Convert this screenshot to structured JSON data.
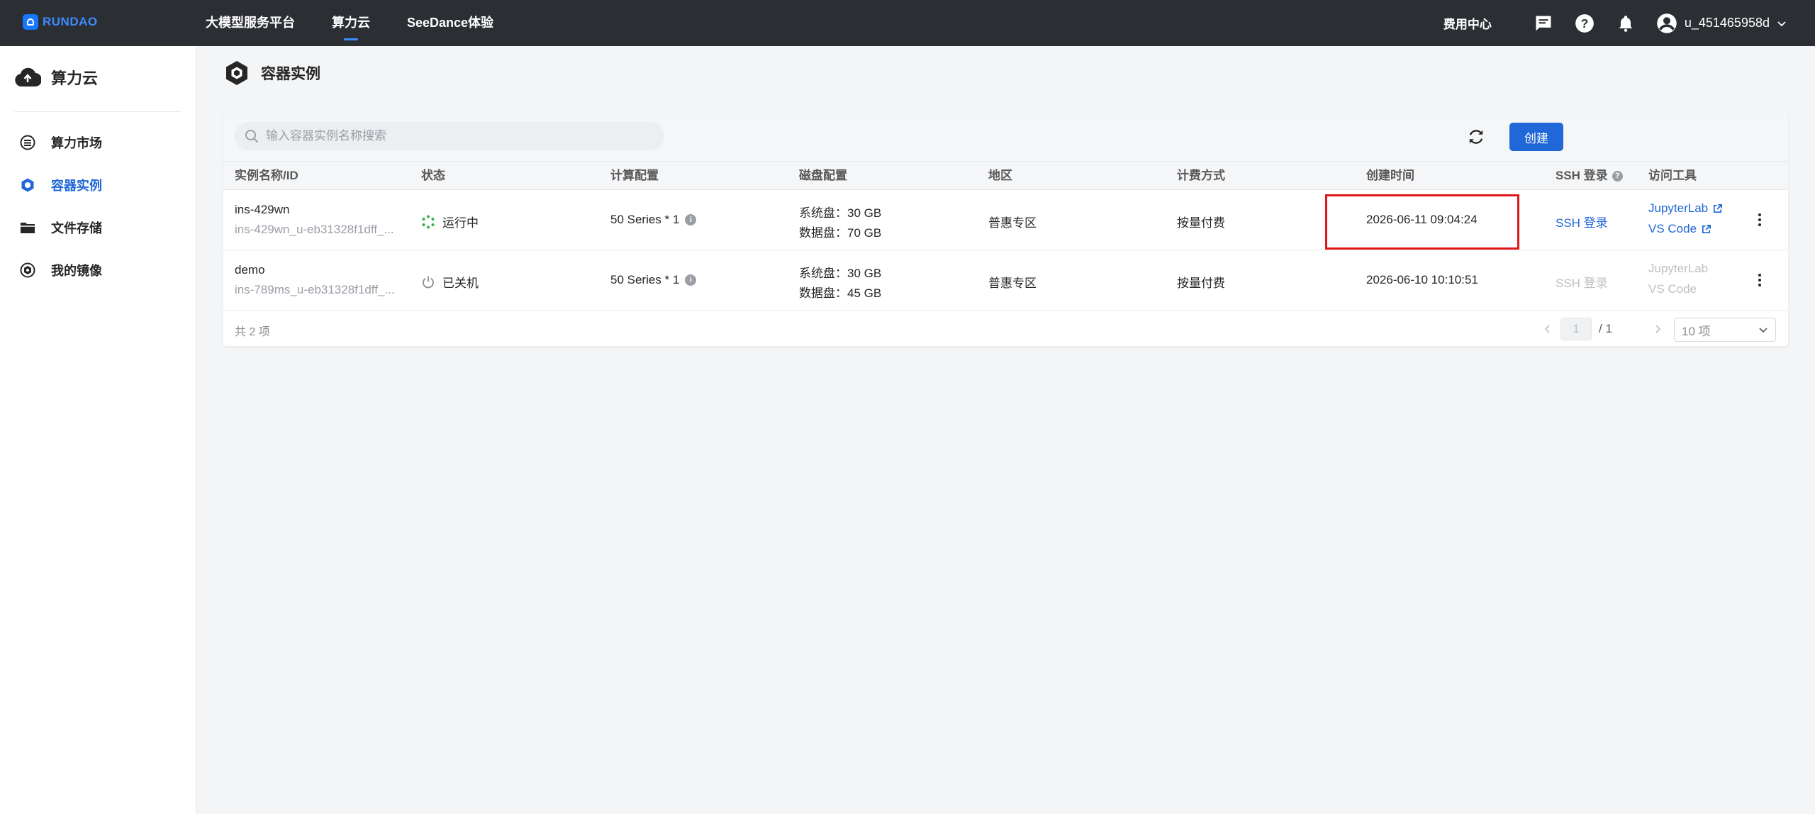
{
  "topbar": {
    "logo_text": "RUNDAO",
    "nav": [
      "大模型服务平台",
      "算力云",
      "SeeDance体验"
    ],
    "active_nav_index": 1,
    "fee_center": "费用中心",
    "username": "u_451465958d",
    "icons": [
      "message-icon",
      "help-icon",
      "bell-icon",
      "user-icon",
      "chevron-down-icon"
    ]
  },
  "sidebar": {
    "title": "算力云",
    "items": [
      {
        "label": "算力市场",
        "icon": "market-icon",
        "active": false
      },
      {
        "label": "容器实例",
        "icon": "container-icon",
        "active": true
      },
      {
        "label": "文件存储",
        "icon": "folder-icon",
        "active": false
      },
      {
        "label": "我的镜像",
        "icon": "image-icon",
        "active": false
      }
    ]
  },
  "page": {
    "title": "容器实例"
  },
  "toolbar": {
    "search_placeholder": "输入容器实例名称搜索",
    "create_label": "创建"
  },
  "table": {
    "columns": [
      "实例名称/ID",
      "状态",
      "计算配置",
      "磁盘配置",
      "地区",
      "计费方式",
      "创建时间",
      "SSH 登录",
      "访问工具"
    ],
    "rows": [
      {
        "name": "ins-429wn",
        "id": "ins-429wn_u-eb31328f1dff_...",
        "status": "运行中",
        "compute": "50 Series * 1",
        "system_disk": "系统盘：30 GB",
        "data_disk": "数据盘：70 GB",
        "region": "普惠专区",
        "billing": "按量付费",
        "created": "2026-06-11 09:04:24",
        "ssh": "SSH 登录",
        "tool1": "JupyterLab",
        "tool2": "VS Code"
      },
      {
        "name": "demo",
        "id": "ins-789ms_u-eb31328f1dff_...",
        "status": "已关机",
        "compute": "50 Series * 1",
        "system_disk": "系统盘：30 GB",
        "data_disk": "数据盘：45 GB",
        "region": "普惠专区",
        "billing": "按量付费",
        "created": "2026-06-10 10:10:51",
        "ssh": "SSH 登录",
        "tool1": "JupyterLab",
        "tool2": "VS Code"
      }
    ]
  },
  "footer": {
    "total": "共 2 项",
    "current_page": "1",
    "page_total": "/ 1",
    "page_size": "10 项"
  },
  "colors": {
    "topbar_bg": "#2b2e33",
    "primary": "#2067d8",
    "running": "#2fb34b",
    "highlight": "#e0161b"
  }
}
